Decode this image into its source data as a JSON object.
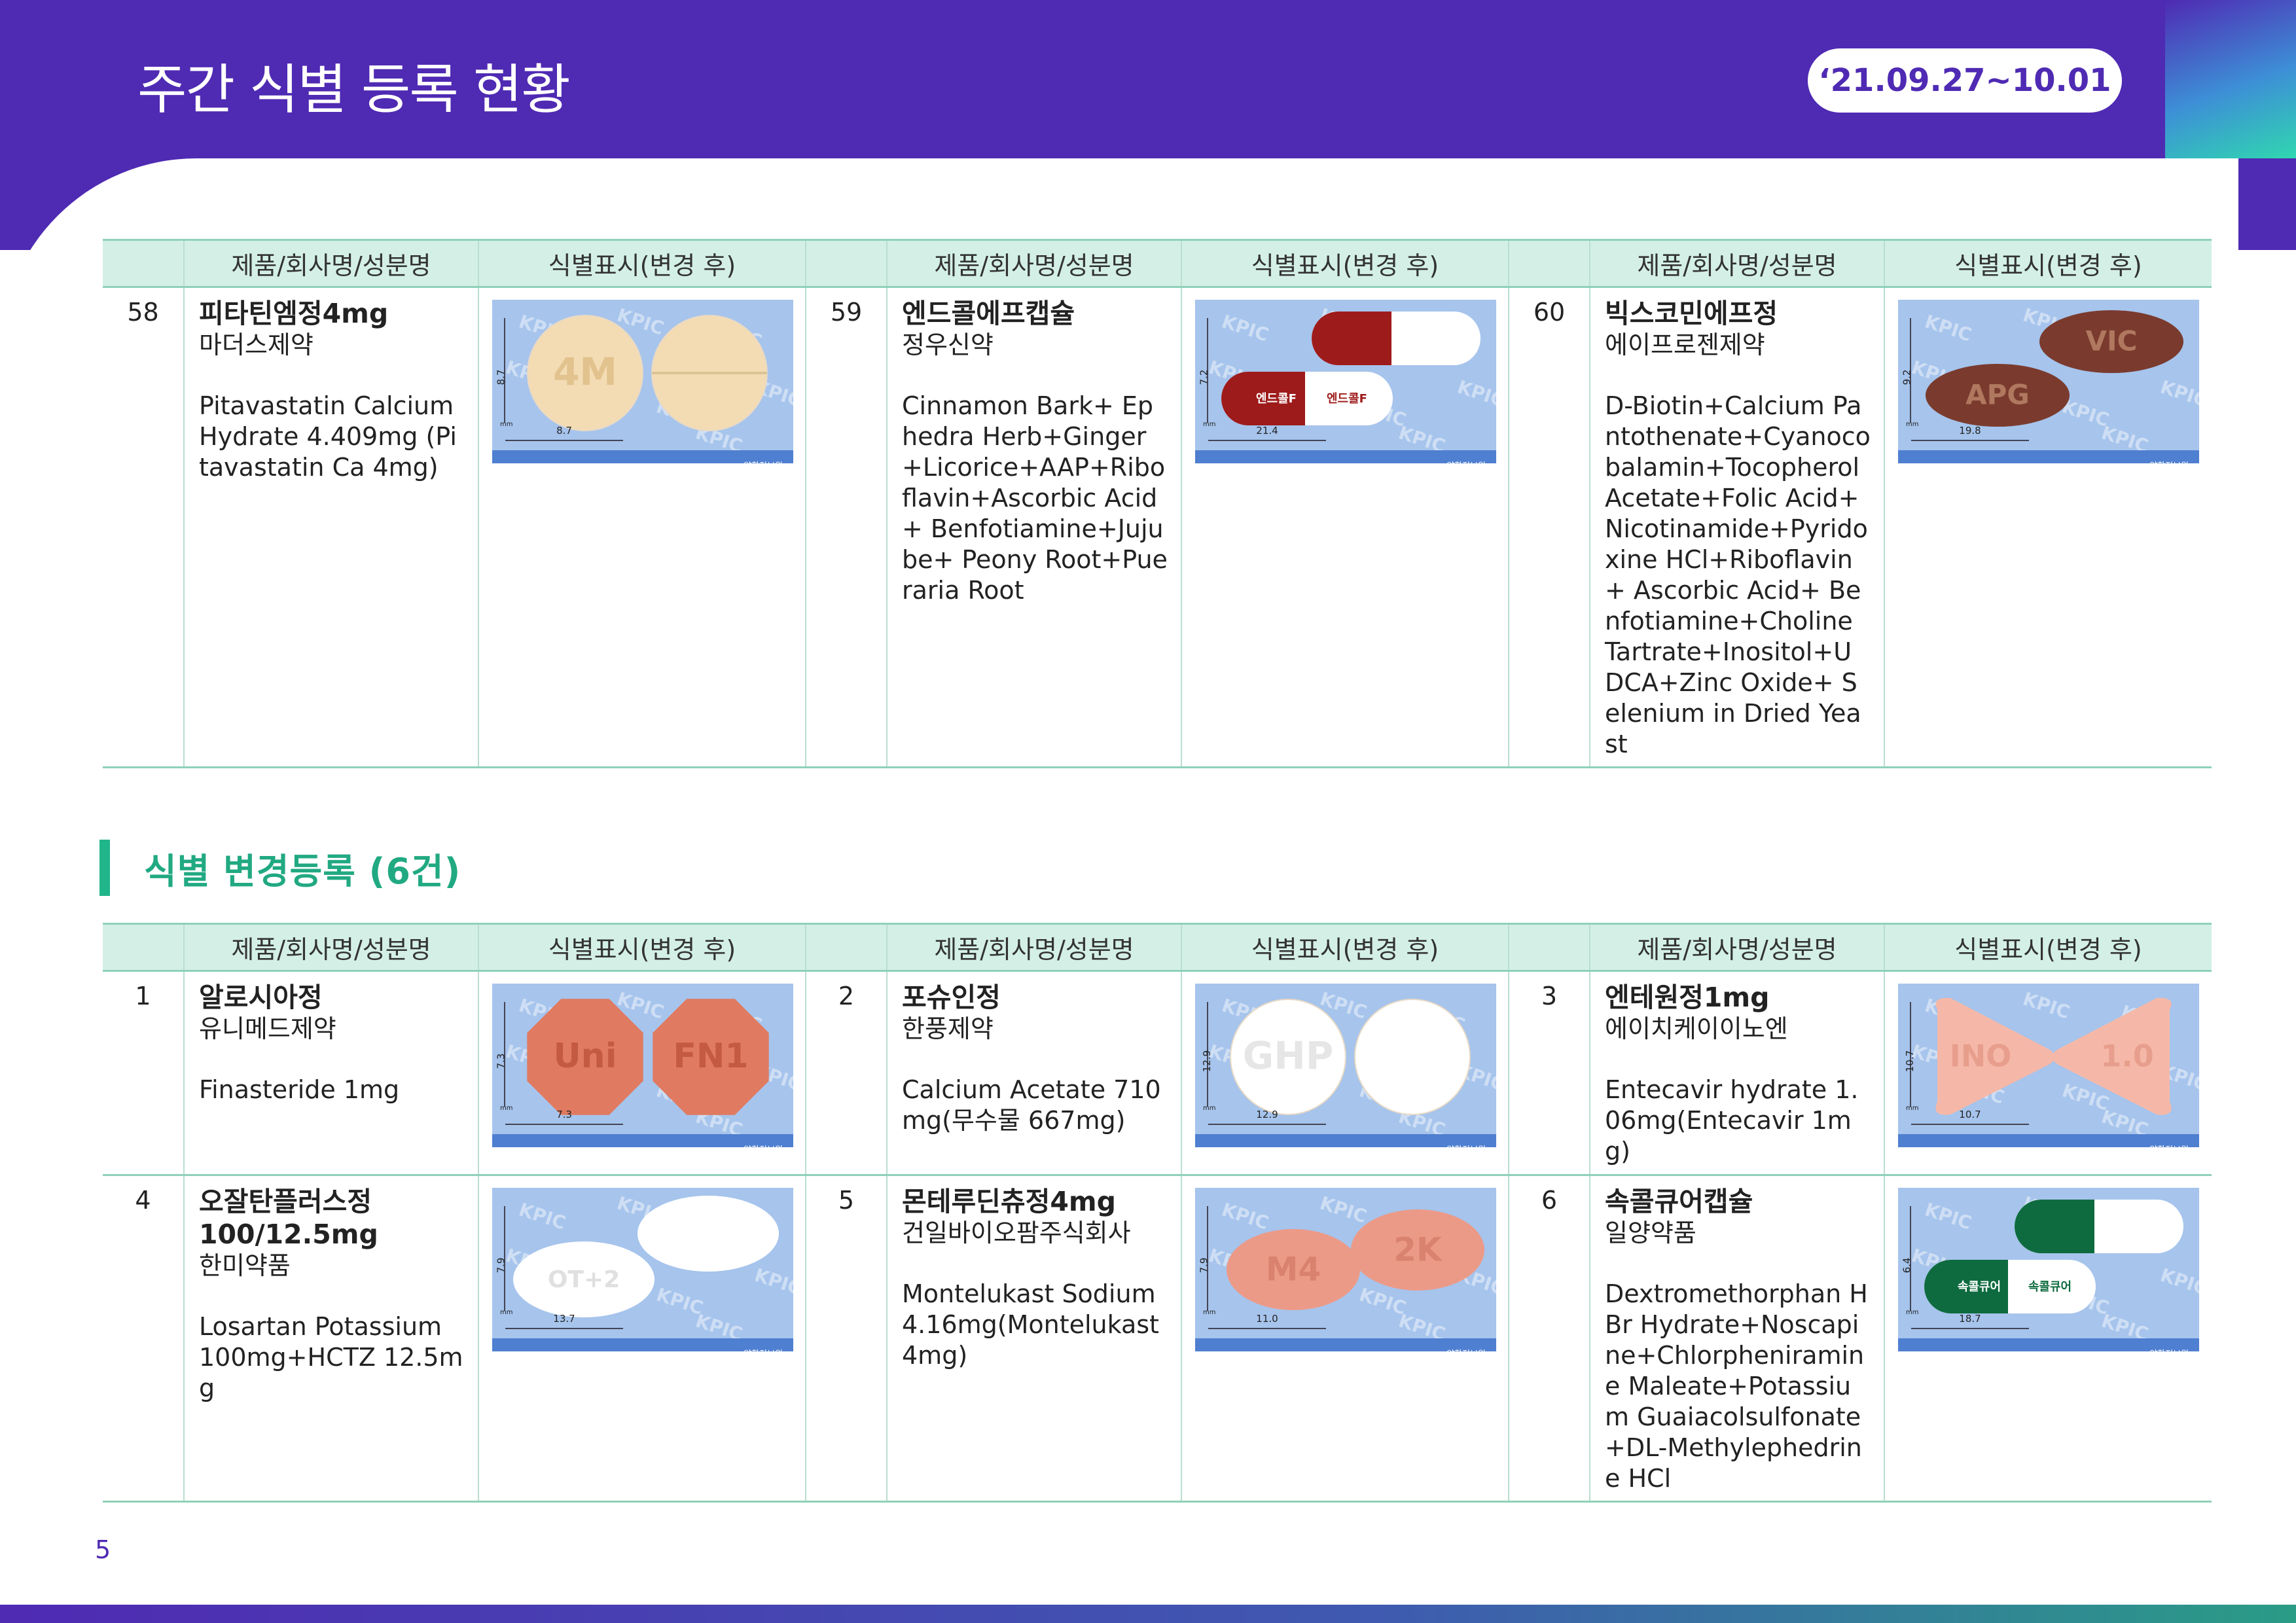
{
  "header": {
    "title": "주간 식별 등록 현황",
    "date_range": "‘21.09.27~10.01"
  },
  "columns": {
    "product": "제품/회사명/성분명",
    "marking": "식별표시(변경 후)"
  },
  "watermark": "KPIC",
  "card_footer": "약학정보원",
  "card_unit": "mm",
  "top_rows": [
    [
      {
        "no": "58",
        "name": "피타틴엠정4mg",
        "company": "마더스제약",
        "ingredients": "Pitavastatin Calcium Hydrate 4.409mg (Pitavastatin Ca 4mg)",
        "size_w": "8.7",
        "size_h": "8.7",
        "shape": "round",
        "color": "#f3dcb4",
        "mark1": "4M",
        "mark2": "",
        "mark_color": "#e2c28d"
      },
      {
        "no": "59",
        "name": "엔드콜에프캡슐",
        "company": "정우신약",
        "ingredients": "Cinnamon Bark+ Ephedra Herb+Ginger +Licorice+AAP+Riboflavin+Ascorbic Acid+ Benfotiamine+Jujube+ Peony Root+Pueraria Root",
        "size_w": "21.4",
        "size_h": "7.2",
        "shape": "capsule",
        "color": "#9e1b1b",
        "mark1": "엔드콜F",
        "mark2": "엔드콜F",
        "mark_color": "#ffffff"
      },
      {
        "no": "60",
        "name": "빅스코민에프정",
        "company": "에이프로젠제약",
        "ingredients": "D-Biotin+Calcium Pantothenate+Cyanocobalamin+Tocopherol Acetate+Folic Acid+ Nicotinamide+Pyridoxine HCl+Riboflavin+ Ascorbic Acid+ Benfotiamine+Choline Tartrate+Inositol+UDCA+Zinc Oxide+ Selenium in Dried Yeast",
        "size_w": "19.8",
        "size_h": "9.2",
        "shape": "oval",
        "color": "#7a3b2e",
        "mark1": "APG",
        "mark2": "VIC",
        "mark_color": "#b0785f"
      }
    ]
  ],
  "section": {
    "title": "식별  변경등록  (6건)"
  },
  "change_rows": [
    [
      {
        "no": "1",
        "name": "알로시아정",
        "company": "유니메드제약",
        "ingredients": "Finasteride 1mg",
        "size_w": "7.3",
        "size_h": "7.3",
        "shape": "octagon",
        "color": "#e07a60",
        "mark1": "Uni",
        "mark2": "FN1",
        "mark_color": "#c45a42"
      },
      {
        "no": "2",
        "name": "포슈인정",
        "company": "한풍제약",
        "ingredients": "Calcium Acetate 710mg(무수물 667mg)",
        "size_w": "12.9",
        "size_h": "12.9",
        "shape": "round",
        "color": "#ffffff",
        "mark1": "GHP",
        "mark2": "",
        "mark_color": "#e6e6e6"
      },
      {
        "no": "3",
        "name": "엔테원정1mg",
        "company": "에이치케이이노엔",
        "ingredients": "Entecavir hydrate 1.06mg(Entecavir 1mg)",
        "size_w": "10.7",
        "size_h": "10.7",
        "shape": "triangle",
        "color": "#f5b8a8",
        "mark1": "INO",
        "mark2": "1.0",
        "mark_color": "#e89e8c"
      }
    ],
    [
      {
        "no": "4",
        "name": "오잘탄플러스정 100/12.5mg",
        "company": "한미약품",
        "ingredients": "Losartan Potassium 100mg+HCTZ 12.5mg",
        "size_w": "13.7",
        "size_h": "7.9",
        "shape": "oval-white",
        "color": "#ffffff",
        "mark1": "OT+2",
        "mark2": "",
        "mark_color": "#e0e0e0"
      },
      {
        "no": "5",
        "name": "몬테루딘츄정4mg",
        "company": "건일바이오팜주식회사",
        "ingredients": "Montelukast Sodium 4.16mg(Montelukast 4mg)",
        "size_w": "11.0",
        "size_h": "7.9",
        "shape": "oval-pink",
        "color": "#ec9a88",
        "mark1": "M4",
        "mark2": "2K",
        "mark_color": "#d9826f"
      },
      {
        "no": "6",
        "name": "속콜큐어캡슐",
        "company": "일양약품",
        "ingredients": "Dextromethorphan HBr Hydrate+Noscapine+Chlorpheniramine Maleate+Potassium Guaiacolsulfonate+DL-Methylephedrine HCl",
        "size_w": "18.7",
        "size_h": "6.4",
        "shape": "capsule",
        "color": "#0e6b3f",
        "mark1": "속콜큐어",
        "mark2": "속콜큐어",
        "mark_color": "#ffffff"
      }
    ]
  ],
  "page": {
    "number": "5"
  }
}
